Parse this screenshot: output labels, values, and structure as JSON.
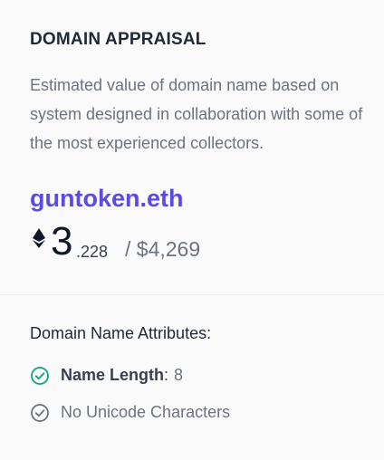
{
  "appraisal": {
    "title": "DOMAIN APPRAISAL",
    "description": "Estimated value of domain name based on system designed in collaboration with some of the most experienced collectors.",
    "domain": "guntoken.eth",
    "price": {
      "icon": "ethereum-icon",
      "eth_integer": "3",
      "eth_decimal": ".228",
      "usd": "/ $4,269"
    }
  },
  "attributes": {
    "heading": "Domain Name Attributes:",
    "items": [
      {
        "icon": "check-circle-icon",
        "status": "passed",
        "status_color": "#10a37f",
        "label": "Name Length",
        "separator": ":",
        "value": "8"
      },
      {
        "icon": "check-circle-icon",
        "status": "neutral",
        "status_color": "#6b7280",
        "label": "No Unicode Characters"
      }
    ]
  },
  "colors": {
    "accent": "#5b4ae6",
    "title_text": "#1f2937",
    "muted_text": "#6b7280",
    "card_background": "#fafafa"
  }
}
